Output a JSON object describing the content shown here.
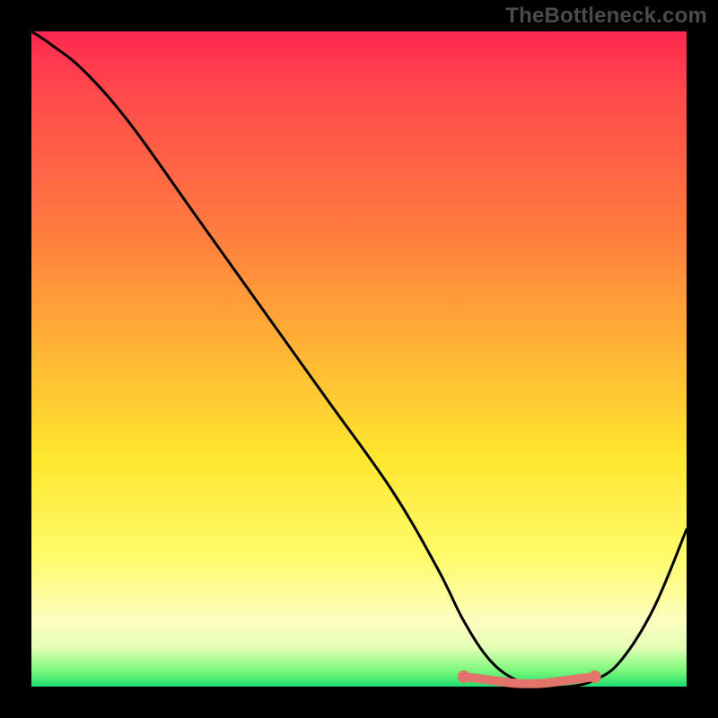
{
  "watermark": "TheBottleneck.com",
  "chart_data": {
    "type": "line",
    "title": "",
    "xlabel": "",
    "ylabel": "",
    "xlim": [
      0,
      100
    ],
    "ylim": [
      0,
      100
    ],
    "series": [
      {
        "name": "bottleneck-curve",
        "x": [
          0,
          3,
          8,
          15,
          25,
          35,
          45,
          55,
          62,
          66,
          70,
          74,
          78,
          82,
          86,
          90,
          95,
          100
        ],
        "values": [
          100,
          98,
          94,
          86,
          72,
          58,
          44,
          30,
          18,
          10,
          4,
          1,
          0,
          0,
          1,
          4,
          12,
          24
        ]
      },
      {
        "name": "optimal-range-highlight",
        "x": [
          66,
          70,
          74,
          78,
          82,
          86
        ],
        "values": [
          1.5,
          1.0,
          0.5,
          0.5,
          1.0,
          1.5
        ]
      }
    ],
    "annotations": []
  },
  "colors": {
    "background": "#000000",
    "curve": "#000000",
    "highlight": "#e2746b",
    "watermark": "#4b4b4b"
  }
}
